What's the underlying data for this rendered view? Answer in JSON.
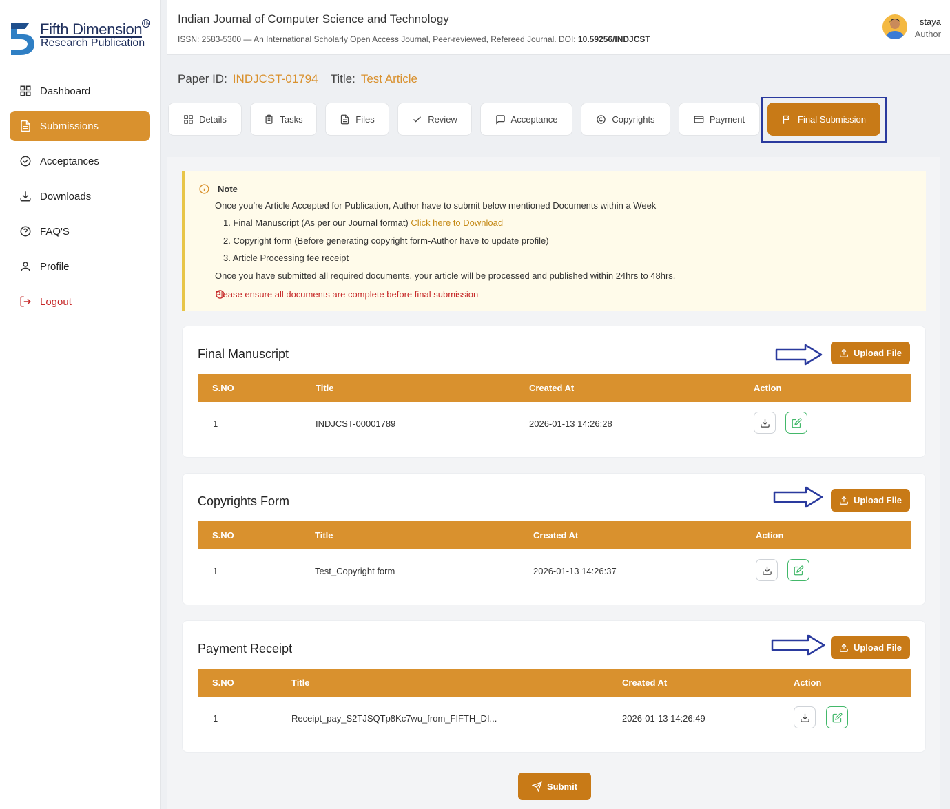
{
  "brand": {
    "line1": "Fifth Dimension",
    "line2": "Research Publication",
    "tm": "TM"
  },
  "sidebar": {
    "items": [
      {
        "label": "Dashboard",
        "icon": "dashboard-icon"
      },
      {
        "label": "Submissions",
        "icon": "document-icon",
        "active": true
      },
      {
        "label": "Acceptances",
        "icon": "check-circle-icon"
      },
      {
        "label": "Downloads",
        "icon": "download-icon"
      },
      {
        "label": "FAQ'S",
        "icon": "help-circle-icon"
      },
      {
        "label": "Profile",
        "icon": "user-icon"
      },
      {
        "label": "Logout",
        "icon": "logout-icon"
      }
    ]
  },
  "header": {
    "journal_title": "Indian Journal of Computer Science and Technology",
    "journal_subtitle": "ISSN: 2583-5300 — An International Scholarly Open Access Journal, Peer-reviewed, Refereed Journal. DOI: ",
    "doi": "10.59256/INDJCST",
    "user_name": "staya",
    "user_role": "Author"
  },
  "paper": {
    "id_label": "Paper ID:",
    "id_value": "INDJCST-01794",
    "title_label": "Title:",
    "title_value": "Test Article"
  },
  "tabs": [
    {
      "label": "Details",
      "icon": "grid-icon"
    },
    {
      "label": "Tasks",
      "icon": "clipboard-icon"
    },
    {
      "label": "Files",
      "icon": "file-icon"
    },
    {
      "label": "Review",
      "icon": "check-icon"
    },
    {
      "label": "Acceptance",
      "icon": "message-icon"
    },
    {
      "label": "Copyrights",
      "icon": "copyright-icon"
    },
    {
      "label": "Payment",
      "icon": "credit-card-icon"
    },
    {
      "label": "Final Submission",
      "icon": "flag-icon",
      "active": true
    }
  ],
  "note": {
    "heading": "Note",
    "intro": "Once you're Article Accepted for Publication, Author have to submit below mentioned Documents within a Week",
    "item1": "1. Final Manuscript (As per our Journal format)",
    "item1_link": "Click here to Download",
    "item2": "2. Copyright form (Before generating copyright form-Author have to update profile)",
    "item3": "3. Article Processing fee receipt",
    "outro": "Once you have submitted all required documents, your article will be processed and published within 24hrs to 48hrs.",
    "warning": "Please ensure all documents are complete before final submission"
  },
  "sections": [
    {
      "title": "Final Manuscript",
      "upload_label": "Upload File",
      "headers": [
        "S.NO",
        "Title",
        "Created At",
        "Action"
      ],
      "rows": [
        {
          "sno": "1",
          "title": "INDJCST-00001789",
          "created": "2026-01-13 14:26:28"
        }
      ]
    },
    {
      "title": "Copyrights Form",
      "upload_label": "Upload File",
      "headers": [
        "S.NO",
        "Title",
        "Created At",
        "Action"
      ],
      "rows": [
        {
          "sno": "1",
          "title": "Test_Copyright form",
          "created": "2026-01-13 14:26:37"
        }
      ]
    },
    {
      "title": "Payment Receipt",
      "upload_label": "Upload File",
      "headers": [
        "S.NO",
        "Title",
        "Created At",
        "Action"
      ],
      "rows": [
        {
          "sno": "1",
          "title": "Receipt_pay_S2TJSQTp8Kc7wu_from_FIFTH_DI...",
          "created": "2026-01-13 14:26:49"
        }
      ]
    }
  ],
  "submit_label": "Submit",
  "colors": {
    "accent": "#d9912e",
    "accent_dark": "#c87a17",
    "danger": "#c62828",
    "highlight_border": "#2a3a9e",
    "note_bg": "#fffbea"
  }
}
